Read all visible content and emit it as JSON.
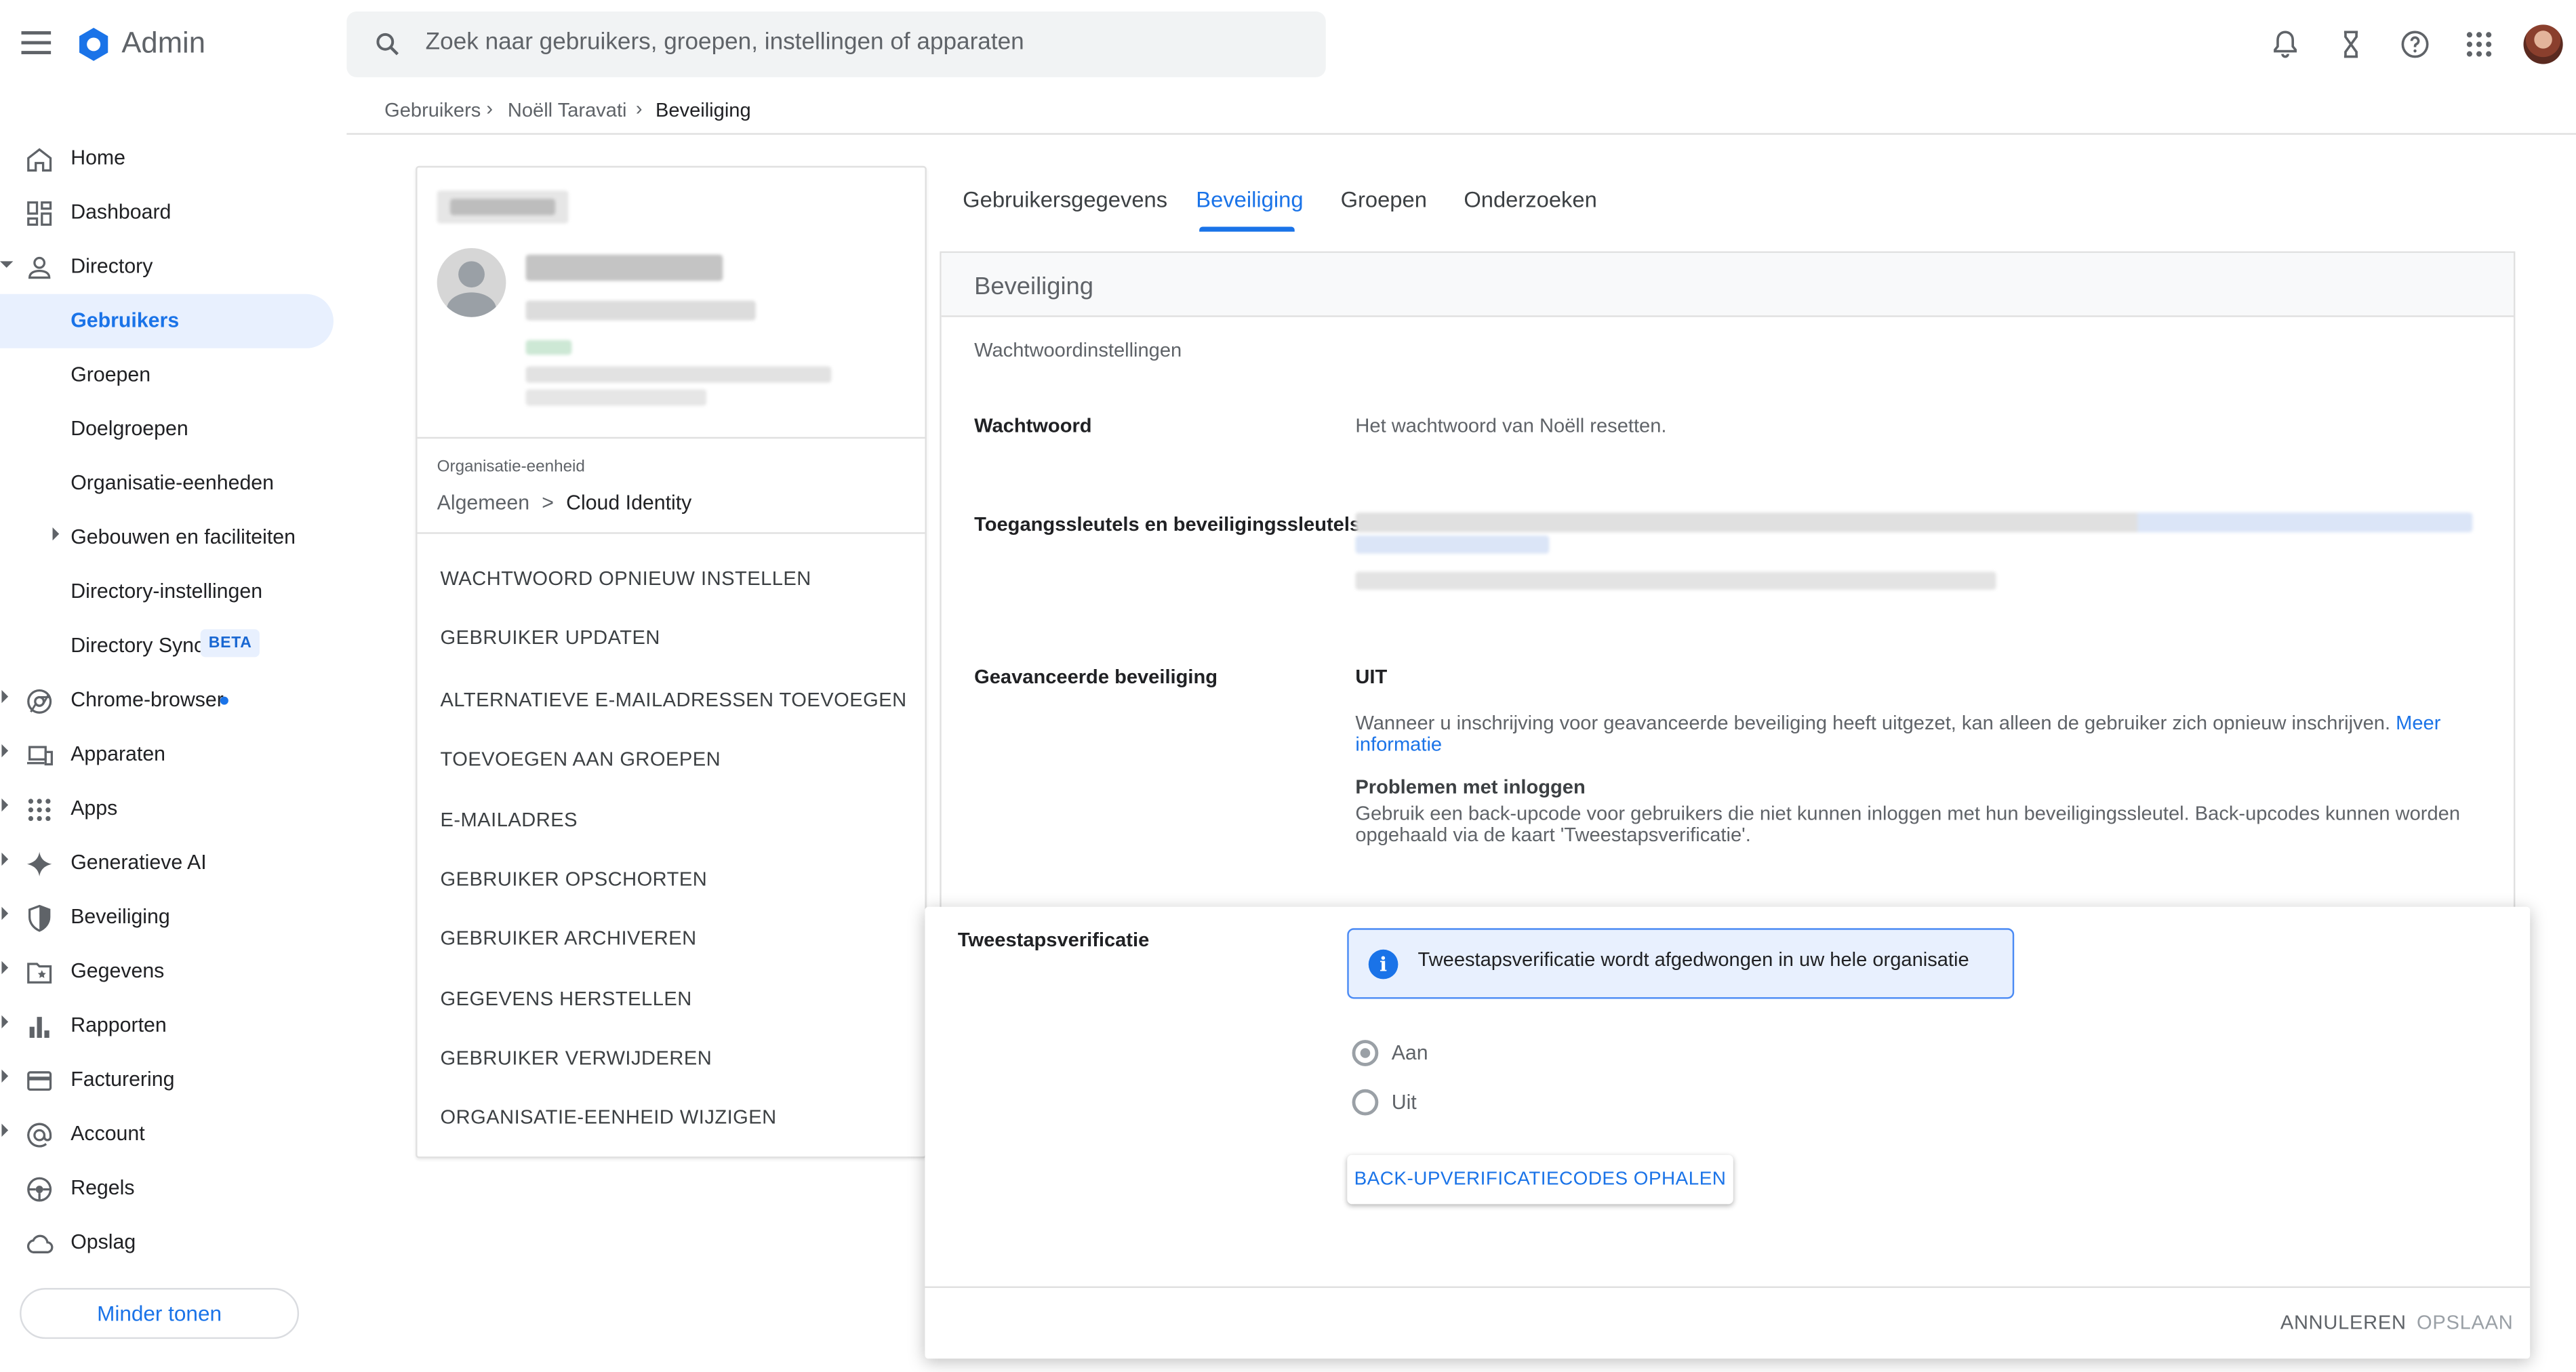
{
  "header": {
    "brand": "Admin",
    "search_placeholder": "Zoek naar gebruikers, groepen, instellingen of apparaten",
    "icons": [
      "menu-icon",
      "admin-logo-icon",
      "search-icon",
      "notifications-bell-icon",
      "hourglass-tasks-icon",
      "help-icon",
      "apps-grid-icon",
      "account-avatar"
    ]
  },
  "breadcrumb": {
    "items": [
      "Gebruikers",
      "Noëll Taravati",
      "Beveiliging"
    ]
  },
  "sidebar": {
    "items": [
      {
        "label": "Home",
        "icon": "home-icon"
      },
      {
        "label": "Dashboard",
        "icon": "dashboard-icon"
      },
      {
        "label": "Directory",
        "icon": "person-icon"
      },
      {
        "label": "Gebruikers"
      },
      {
        "label": "Groepen"
      },
      {
        "label": "Doelgroepen"
      },
      {
        "label": "Organisatie-eenheden"
      },
      {
        "label": "Gebouwen en faciliteiten"
      },
      {
        "label": "Directory-instellingen"
      },
      {
        "label": "Directory Sync",
        "badge": "BETA"
      },
      {
        "label": "Chrome-browser",
        "icon": "chrome-icon"
      },
      {
        "label": "Apparaten",
        "icon": "devices-icon"
      },
      {
        "label": "Apps",
        "icon": "apps-icon"
      },
      {
        "label": "Generatieve AI",
        "icon": "sparkle-icon"
      },
      {
        "label": "Beveiliging",
        "icon": "shield-icon"
      },
      {
        "label": "Gegevens",
        "icon": "folder-star-icon"
      },
      {
        "label": "Rapporten",
        "icon": "bar-chart-icon"
      },
      {
        "label": "Facturering",
        "icon": "credit-card-icon"
      },
      {
        "label": "Account",
        "icon": "at-sign-icon"
      },
      {
        "label": "Regels",
        "icon": "rules-icon"
      },
      {
        "label": "Opslag",
        "icon": "cloud-icon"
      }
    ],
    "show_less": "Minder tonen"
  },
  "user_card": {
    "org_unit_label": "Organisatie-eenheid",
    "org_path_parent": "Algemeen",
    "org_path_sep": ">",
    "org_path_current": "Cloud Identity",
    "actions": [
      "WACHTWOORD OPNIEUW INSTELLEN",
      "GEBRUIKER UPDATEN",
      "ALTERNATIEVE E-MAILADRESSEN TOEVOEGEN",
      "TOEVOEGEN AAN GROEPEN",
      "E-MAILADRES",
      "GEBRUIKER OPSCHORTEN",
      "GEBRUIKER ARCHIVEREN",
      "GEGEVENS HERSTELLEN",
      "GEBRUIKER VERWIJDEREN",
      "ORGANISATIE-EENHEID WIJZIGEN"
    ]
  },
  "tabs": [
    "Gebruikersgegevens",
    "Beveiliging",
    "Groepen",
    "Onderzoeken"
  ],
  "security": {
    "title": "Beveiliging",
    "subtitle": "Wachtwoordinstellingen",
    "password_label": "Wachtwoord",
    "password_value": "Het wachtwoord van Noëll resetten.",
    "keys_label": "Toegangssleutels en beveiligingssleutels",
    "advanced_label": "Geavanceerde beveiliging",
    "advanced_value": "UIT",
    "advanced_desc": "Wanneer u inschrijving voor geavanceerde beveiliging heeft uitgezet, kan alleen de gebruiker zich opnieuw inschrijven.",
    "advanced_link_1": "Meer",
    "advanced_link_2": "informatie",
    "login_problems_title": "Problemen met inloggen",
    "login_problems_line1": "Gebruik een back-upcode voor gebruikers die niet kunnen inloggen met hun beveiligingssleutel. Back-upcodes kunnen worden",
    "login_problems_line2": "opgehaald via de kaart 'Tweestapsverificatie'."
  },
  "two_step": {
    "label": "Tweestapsverificatie",
    "info": "Tweestapsverificatie wordt afgedwongen in uw hele organisatie",
    "option_on": "Aan",
    "option_off": "Uit",
    "selected": "Aan",
    "backup_button": "BACK-UPVERIFICATIECODES OPHALEN",
    "cancel": "ANNULEREN",
    "save": "OPSLAAN"
  },
  "colors": {
    "accent": "#1a73e8",
    "active_nav_bg": "#e8f0fe",
    "info_bg": "#e8f0fe"
  }
}
